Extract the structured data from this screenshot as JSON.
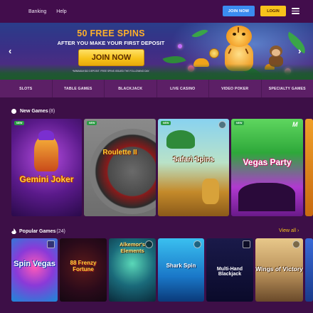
{
  "topnav": {
    "links": [
      "Banking",
      "Help"
    ],
    "join_label": "JOIN NOW",
    "login_label": "LOGIN",
    "menu_icon": "hamburger-menu-icon"
  },
  "hero": {
    "title": "50 FREE SPINS",
    "subtitle": "AFTER YOU MAKE YOUR FIRST DEPOSIT",
    "cta_label": "JOIN NOW",
    "fine_print": "*MINIMUM $10 DEPOSIT. FREE SPINS ISSUED THE FOLLOWING DAY.",
    "prev_icon": "chevron-left-icon",
    "next_icon": "chevron-right-icon"
  },
  "categories": [
    "SLOTS",
    "TABLE GAMES",
    "BLACKJACK",
    "LIVE CASINO",
    "VIDEO POKER",
    "SPECIALTY GAMES"
  ],
  "new_games": {
    "title": "New Games",
    "count": "(8)",
    "badge_label": "NEW",
    "tiles": [
      "Gemini Joker",
      "Roulette II",
      "Safari Spins",
      "Vegas Party"
    ]
  },
  "popular_games": {
    "title": "Popular Games",
    "count": "(24)",
    "view_all_label": "View all",
    "tiles": [
      "Spin Vegas",
      "88 Frenzy Fortune",
      "Alkemor's Elements",
      "Shark Spin",
      "Multi-Hand Blackjack",
      "Wings of Victory"
    ]
  },
  "colors": {
    "background": "#3d0f47",
    "nav": "#420d4c",
    "category_bar": "#5c1f66",
    "join_button": "#3b8cf0",
    "login_button": "#f7c31b",
    "accent_gold": "#ffb02a",
    "view_all": "#f7c31b"
  }
}
